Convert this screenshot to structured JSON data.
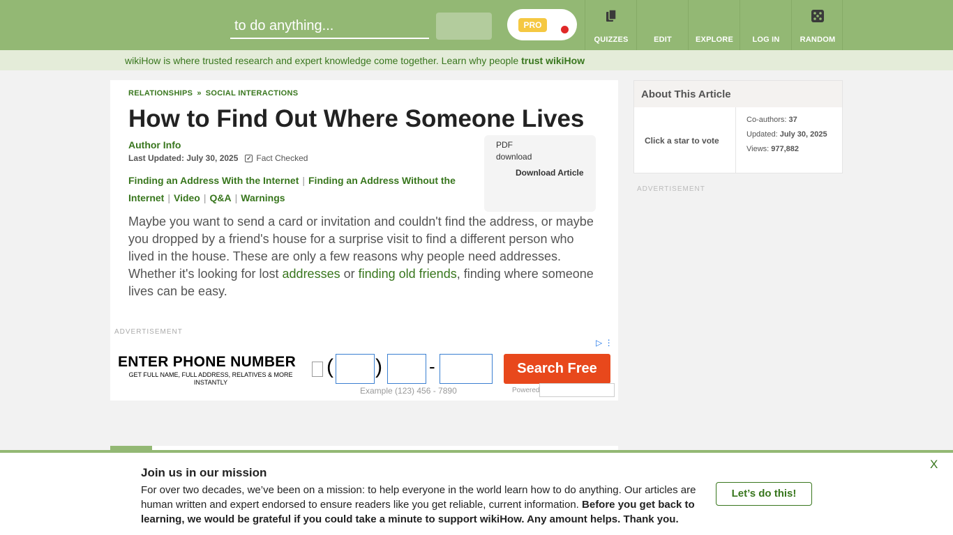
{
  "header": {
    "search_placeholder": "to do anything...",
    "pro_label": "PRO",
    "nav": [
      {
        "label": "QUIZZES",
        "icon": "quiz-icon"
      },
      {
        "label": "EDIT",
        "icon": "edit-icon"
      },
      {
        "label": "EXPLORE",
        "icon": "explore-icon"
      },
      {
        "label": "LOG IN",
        "icon": "login-icon"
      },
      {
        "label": "RANDOM",
        "icon": "dice-icon"
      }
    ]
  },
  "trust": {
    "text": "wikiHow is where trusted research and expert knowledge come together. Learn why people ",
    "link": "trust wikiHow"
  },
  "article": {
    "breadcrumb": [
      "RELATIONSHIPS",
      "SOCIAL INTERACTIONS"
    ],
    "breadcrumb_sep": "»",
    "title": "How to Find Out Where Someone Lives",
    "author": "Author Info",
    "last_updated": "Last Updated: July 30, 2025",
    "fact_checked": "Fact Checked",
    "toc": [
      "Finding an Address With the Internet",
      "Finding an Address Without the Internet",
      "Video",
      "Q&A",
      "Warnings"
    ],
    "toc_sep": "|",
    "download_label": "Download Article",
    "pdf_alt": "PDF download",
    "intro_1": "Maybe you want to send a card or invitation and couldn't find the address, or maybe you dropped by a friend's house for a surprise visit to find a different person who lived in the house. These are only a few reasons why people need addresses. Whether it's looking for lost ",
    "intro_link1": "addresses",
    "intro_2": " or ",
    "intro_link2": "finding old friends",
    "intro_3": ", finding where someone lives can be easy."
  },
  "ad": {
    "label": "ADVERTISEMENT",
    "headline": "ENTER PHONE NUMBER",
    "subtext": "GET FULL NAME, FULL ADDRESS, RELATIVES & MORE INSTANTLY",
    "example": "Example (123) 456 - 7890",
    "button": "Search Free",
    "powered": "Powered",
    "paren_open": "(",
    "paren_close": ")",
    "dash": "-"
  },
  "sidebar": {
    "title": "About This Article",
    "vote": "Click a star to vote",
    "coauthors_label": "Co-authors:",
    "coauthors": "37",
    "updated_label": "Updated:",
    "updated": "July 30, 2025",
    "views_label": "Views:",
    "views": "977,882",
    "ad_label": "ADVERTISEMENT"
  },
  "banner": {
    "title": "Join us in our mission",
    "text": "For over two decades, we’ve been on a mission: to help everyone in the world learn how to do anything. Our articles are human written and expert endorsed to ensure readers like you get reliable, current information. ",
    "bold": "Before you get back to learning, we would be grateful if you could take a minute to support wikiHow. Any amount helps. Thank you.",
    "button": "Let’s do this!",
    "close": "X"
  },
  "colors": {
    "brand_green": "#93b874",
    "link_green": "#38761d",
    "ad_button": "#e8481c"
  }
}
